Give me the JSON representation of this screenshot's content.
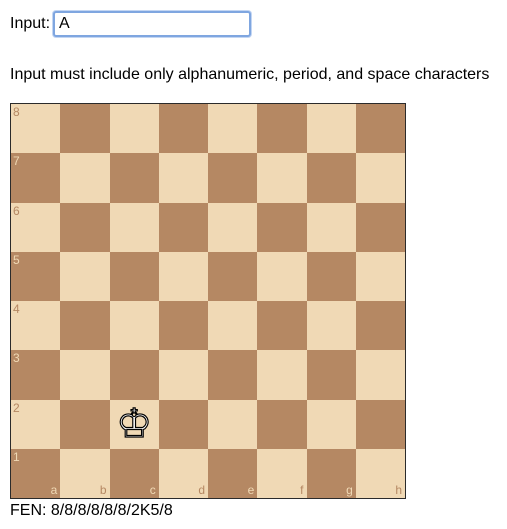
{
  "form": {
    "input_label": "Input:",
    "input_value": "A",
    "hint": "Input must include only alphanumeric, period, and space characters"
  },
  "board": {
    "ranks": [
      "8",
      "7",
      "6",
      "5",
      "4",
      "3",
      "2",
      "1"
    ],
    "files": [
      "a",
      "b",
      "c",
      "d",
      "e",
      "f",
      "g",
      "h"
    ],
    "light_color": "#f0d9b5",
    "dark_color": "#b58863",
    "pieces": [
      {
        "square": "c2",
        "piece": "white-king",
        "glyph": "♔"
      }
    ]
  },
  "fen": "FEN: 8/8/8/8/8/8/2K5/8"
}
